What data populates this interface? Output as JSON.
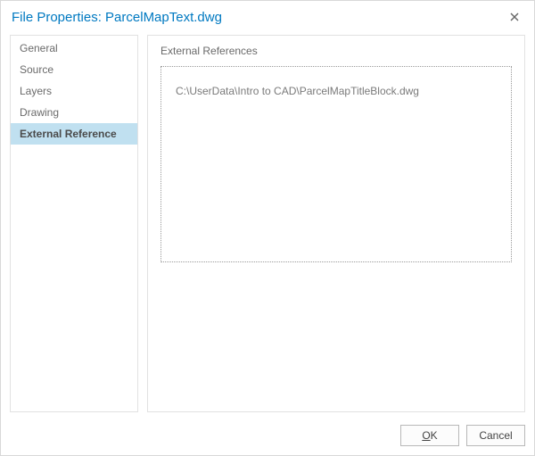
{
  "title_prefix": "File Properties: ",
  "file_name": "ParcelMapText.dwg",
  "close_button_label": "Close",
  "sidebar": {
    "items": [
      {
        "label": "General"
      },
      {
        "label": "Source"
      },
      {
        "label": "Layers"
      },
      {
        "label": "Drawing"
      },
      {
        "label": "External Reference"
      }
    ],
    "selected_index": 4
  },
  "panel": {
    "heading": "External References",
    "references": [
      "C:\\UserData\\Intro to CAD\\ParcelMapTitleBlock.dwg"
    ]
  },
  "buttons": {
    "ok_accel": "O",
    "ok_rest": "K",
    "cancel": "Cancel"
  }
}
